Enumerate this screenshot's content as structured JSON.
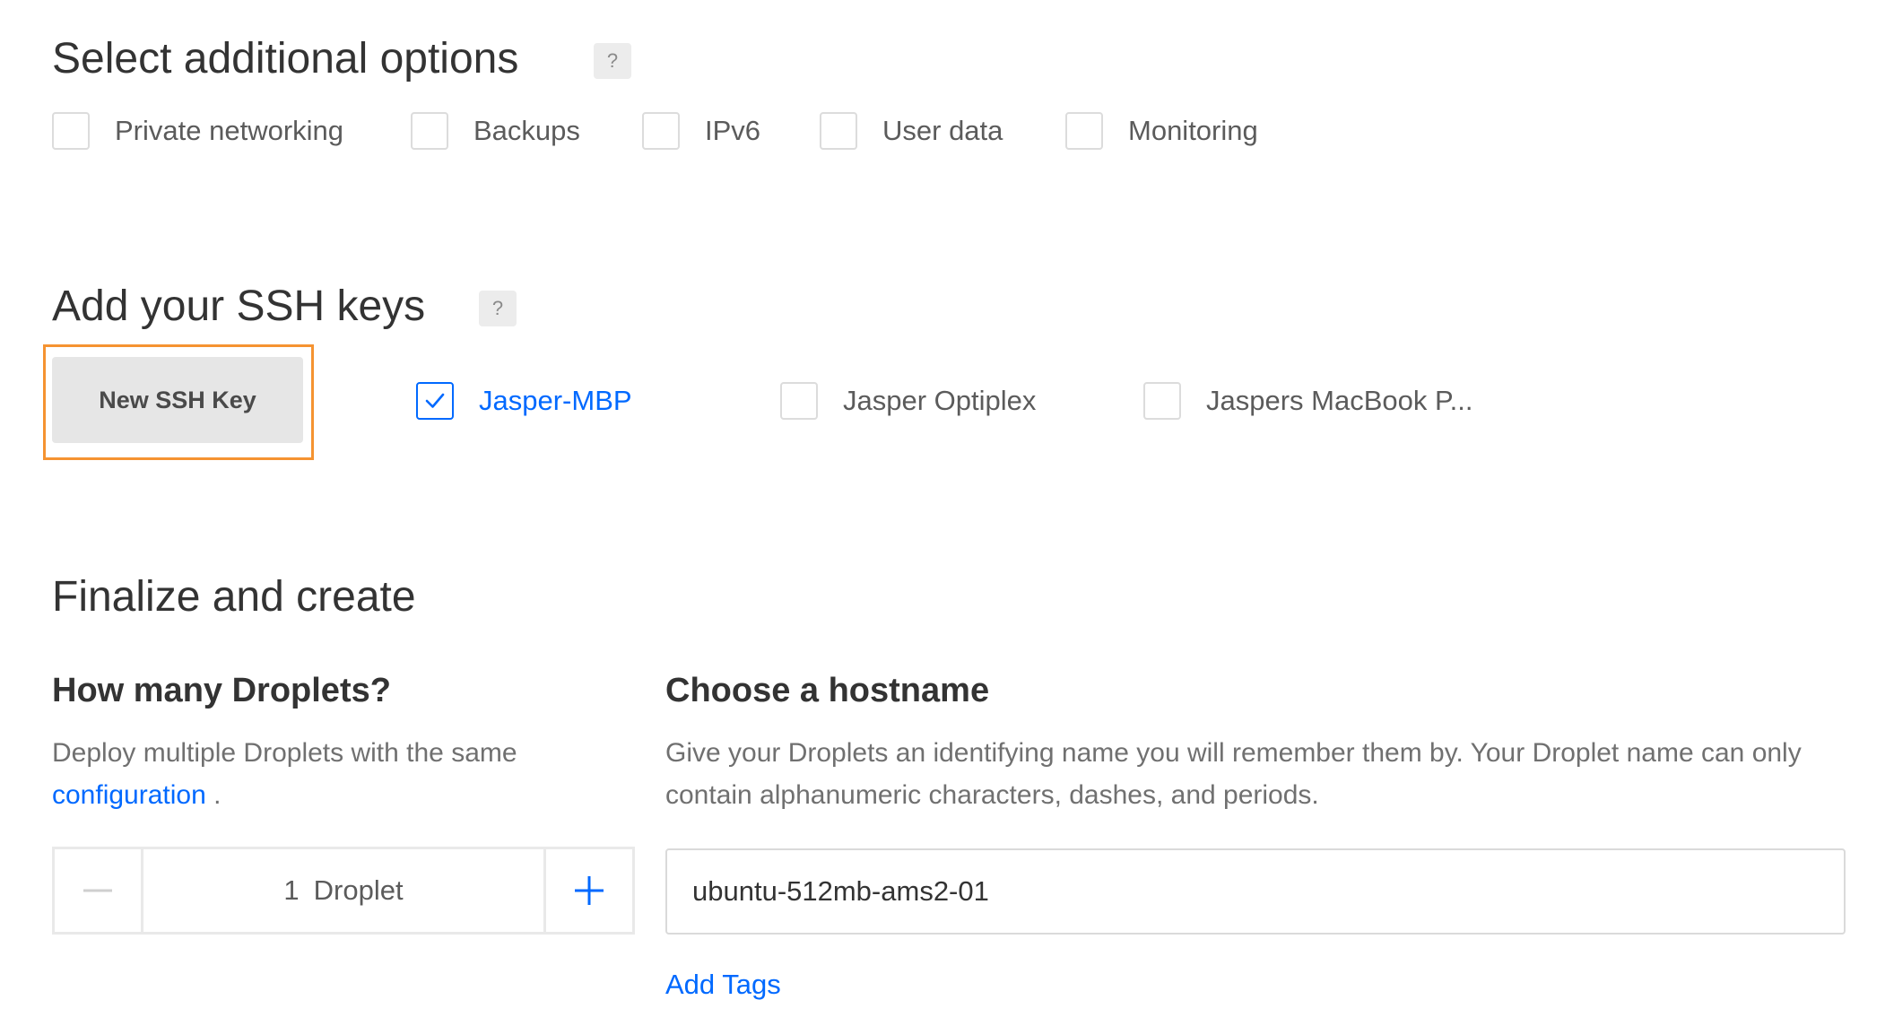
{
  "additional_options": {
    "title": "Select additional options",
    "help": "?",
    "options": [
      {
        "label": "Private networking",
        "checked": false
      },
      {
        "label": "Backups",
        "checked": false
      },
      {
        "label": "IPv6",
        "checked": false
      },
      {
        "label": "User data",
        "checked": false
      },
      {
        "label": "Monitoring",
        "checked": false
      }
    ]
  },
  "ssh_keys": {
    "title": "Add your SSH keys",
    "help": "?",
    "new_key_label": "New SSH Key",
    "keys": [
      {
        "label": "Jasper-MBP",
        "checked": true
      },
      {
        "label": "Jasper Optiplex",
        "checked": false
      },
      {
        "label": "Jaspers MacBook P...",
        "checked": false
      }
    ]
  },
  "finalize": {
    "title": "Finalize and create",
    "droplets": {
      "title": "How many Droplets?",
      "desc_text": "Deploy multiple Droplets with the same",
      "desc_link": "configuration",
      "desc_suffix": " .",
      "count": "1",
      "unit": "Droplet"
    },
    "hostname": {
      "title": "Choose a hostname",
      "desc": "Give your Droplets an identifying name you will remember them by. Your Droplet name can only contain alphanumeric characters, dashes, and periods.",
      "value": "ubuntu-512mb-ams2-01",
      "add_tags": "Add Tags"
    }
  },
  "colors": {
    "accent": "#0069ff",
    "focus": "#f59331"
  }
}
